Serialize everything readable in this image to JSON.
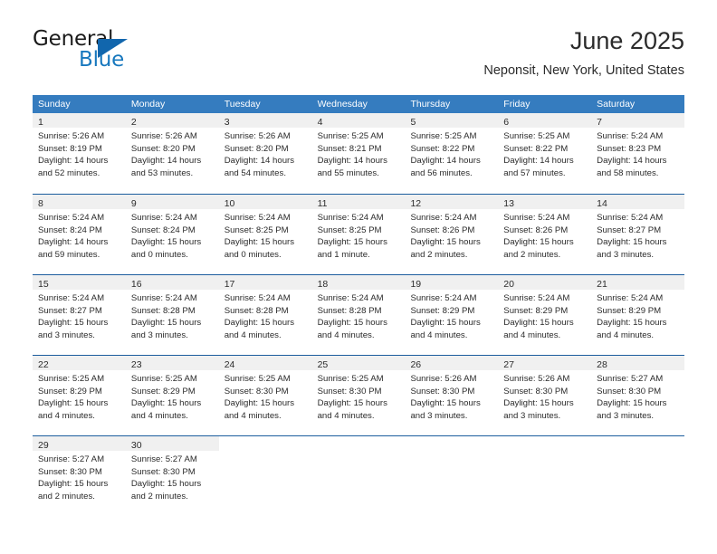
{
  "brand": {
    "name_part1": "General",
    "name_part2": "Blue",
    "triangle_color": "#1166ad"
  },
  "header": {
    "title": "June 2025",
    "location": "Neponsit, New York, United States"
  },
  "theme": {
    "header_blue": "#357cbf",
    "row_separator": "#1c5d9e",
    "daynum_band": "#f0f0f0"
  },
  "calendar": {
    "weekday_headers": [
      "Sunday",
      "Monday",
      "Tuesday",
      "Wednesday",
      "Thursday",
      "Friday",
      "Saturday"
    ],
    "weeks": [
      [
        {
          "day": "1",
          "sunrise": "Sunrise: 5:26 AM",
          "sunset": "Sunset: 8:19 PM",
          "daylight": "Daylight: 14 hours and 52 minutes."
        },
        {
          "day": "2",
          "sunrise": "Sunrise: 5:26 AM",
          "sunset": "Sunset: 8:20 PM",
          "daylight": "Daylight: 14 hours and 53 minutes."
        },
        {
          "day": "3",
          "sunrise": "Sunrise: 5:26 AM",
          "sunset": "Sunset: 8:20 PM",
          "daylight": "Daylight: 14 hours and 54 minutes."
        },
        {
          "day": "4",
          "sunrise": "Sunrise: 5:25 AM",
          "sunset": "Sunset: 8:21 PM",
          "daylight": "Daylight: 14 hours and 55 minutes."
        },
        {
          "day": "5",
          "sunrise": "Sunrise: 5:25 AM",
          "sunset": "Sunset: 8:22 PM",
          "daylight": "Daylight: 14 hours and 56 minutes."
        },
        {
          "day": "6",
          "sunrise": "Sunrise: 5:25 AM",
          "sunset": "Sunset: 8:22 PM",
          "daylight": "Daylight: 14 hours and 57 minutes."
        },
        {
          "day": "7",
          "sunrise": "Sunrise: 5:24 AM",
          "sunset": "Sunset: 8:23 PM",
          "daylight": "Daylight: 14 hours and 58 minutes."
        }
      ],
      [
        {
          "day": "8",
          "sunrise": "Sunrise: 5:24 AM",
          "sunset": "Sunset: 8:24 PM",
          "daylight": "Daylight: 14 hours and 59 minutes."
        },
        {
          "day": "9",
          "sunrise": "Sunrise: 5:24 AM",
          "sunset": "Sunset: 8:24 PM",
          "daylight": "Daylight: 15 hours and 0 minutes."
        },
        {
          "day": "10",
          "sunrise": "Sunrise: 5:24 AM",
          "sunset": "Sunset: 8:25 PM",
          "daylight": "Daylight: 15 hours and 0 minutes."
        },
        {
          "day": "11",
          "sunrise": "Sunrise: 5:24 AM",
          "sunset": "Sunset: 8:25 PM",
          "daylight": "Daylight: 15 hours and 1 minute."
        },
        {
          "day": "12",
          "sunrise": "Sunrise: 5:24 AM",
          "sunset": "Sunset: 8:26 PM",
          "daylight": "Daylight: 15 hours and 2 minutes."
        },
        {
          "day": "13",
          "sunrise": "Sunrise: 5:24 AM",
          "sunset": "Sunset: 8:26 PM",
          "daylight": "Daylight: 15 hours and 2 minutes."
        },
        {
          "day": "14",
          "sunrise": "Sunrise: 5:24 AM",
          "sunset": "Sunset: 8:27 PM",
          "daylight": "Daylight: 15 hours and 3 minutes."
        }
      ],
      [
        {
          "day": "15",
          "sunrise": "Sunrise: 5:24 AM",
          "sunset": "Sunset: 8:27 PM",
          "daylight": "Daylight: 15 hours and 3 minutes."
        },
        {
          "day": "16",
          "sunrise": "Sunrise: 5:24 AM",
          "sunset": "Sunset: 8:28 PM",
          "daylight": "Daylight: 15 hours and 3 minutes."
        },
        {
          "day": "17",
          "sunrise": "Sunrise: 5:24 AM",
          "sunset": "Sunset: 8:28 PM",
          "daylight": "Daylight: 15 hours and 4 minutes."
        },
        {
          "day": "18",
          "sunrise": "Sunrise: 5:24 AM",
          "sunset": "Sunset: 8:28 PM",
          "daylight": "Daylight: 15 hours and 4 minutes."
        },
        {
          "day": "19",
          "sunrise": "Sunrise: 5:24 AM",
          "sunset": "Sunset: 8:29 PM",
          "daylight": "Daylight: 15 hours and 4 minutes."
        },
        {
          "day": "20",
          "sunrise": "Sunrise: 5:24 AM",
          "sunset": "Sunset: 8:29 PM",
          "daylight": "Daylight: 15 hours and 4 minutes."
        },
        {
          "day": "21",
          "sunrise": "Sunrise: 5:24 AM",
          "sunset": "Sunset: 8:29 PM",
          "daylight": "Daylight: 15 hours and 4 minutes."
        }
      ],
      [
        {
          "day": "22",
          "sunrise": "Sunrise: 5:25 AM",
          "sunset": "Sunset: 8:29 PM",
          "daylight": "Daylight: 15 hours and 4 minutes."
        },
        {
          "day": "23",
          "sunrise": "Sunrise: 5:25 AM",
          "sunset": "Sunset: 8:29 PM",
          "daylight": "Daylight: 15 hours and 4 minutes."
        },
        {
          "day": "24",
          "sunrise": "Sunrise: 5:25 AM",
          "sunset": "Sunset: 8:30 PM",
          "daylight": "Daylight: 15 hours and 4 minutes."
        },
        {
          "day": "25",
          "sunrise": "Sunrise: 5:25 AM",
          "sunset": "Sunset: 8:30 PM",
          "daylight": "Daylight: 15 hours and 4 minutes."
        },
        {
          "day": "26",
          "sunrise": "Sunrise: 5:26 AM",
          "sunset": "Sunset: 8:30 PM",
          "daylight": "Daylight: 15 hours and 3 minutes."
        },
        {
          "day": "27",
          "sunrise": "Sunrise: 5:26 AM",
          "sunset": "Sunset: 8:30 PM",
          "daylight": "Daylight: 15 hours and 3 minutes."
        },
        {
          "day": "28",
          "sunrise": "Sunrise: 5:27 AM",
          "sunset": "Sunset: 8:30 PM",
          "daylight": "Daylight: 15 hours and 3 minutes."
        }
      ],
      [
        {
          "day": "29",
          "sunrise": "Sunrise: 5:27 AM",
          "sunset": "Sunset: 8:30 PM",
          "daylight": "Daylight: 15 hours and 2 minutes."
        },
        {
          "day": "30",
          "sunrise": "Sunrise: 5:27 AM",
          "sunset": "Sunset: 8:30 PM",
          "daylight": "Daylight: 15 hours and 2 minutes."
        },
        {
          "day": "",
          "sunrise": "",
          "sunset": "",
          "daylight": ""
        },
        {
          "day": "",
          "sunrise": "",
          "sunset": "",
          "daylight": ""
        },
        {
          "day": "",
          "sunrise": "",
          "sunset": "",
          "daylight": ""
        },
        {
          "day": "",
          "sunrise": "",
          "sunset": "",
          "daylight": ""
        },
        {
          "day": "",
          "sunrise": "",
          "sunset": "",
          "daylight": ""
        }
      ]
    ]
  }
}
